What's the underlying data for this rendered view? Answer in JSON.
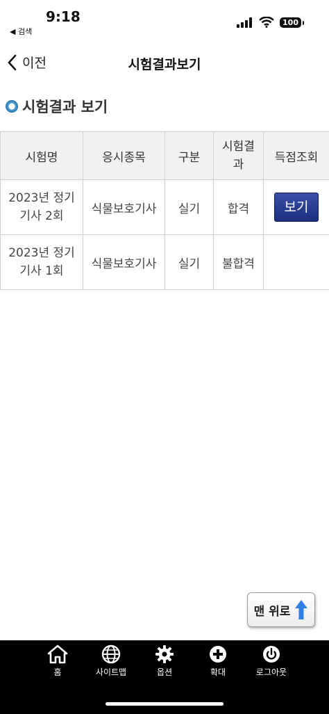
{
  "status_bar": {
    "time": "9:18",
    "back_app": "◀ 검색",
    "battery": "100"
  },
  "nav": {
    "back_label": "이전",
    "title": "시험결과보기"
  },
  "section": {
    "title": "시험결과 보기"
  },
  "table": {
    "headers": [
      "시험명",
      "응시종목",
      "구분",
      "시험결\n과",
      "득점조회"
    ],
    "rows": [
      {
        "exam": "2023년 정기\n기사 2회",
        "subject": "식물보호기사",
        "type": "실기",
        "result": "합격",
        "score_button": "보기"
      },
      {
        "exam": "2023년 정기\n기사 1회",
        "subject": "식물보호기사",
        "type": "실기",
        "result": "불합격",
        "score_button": ""
      }
    ]
  },
  "top_button": {
    "label": "맨 위로"
  },
  "bottom_nav": {
    "items": [
      {
        "label": "홈",
        "icon": "home-icon"
      },
      {
        "label": "사이트맵",
        "icon": "globe-icon"
      },
      {
        "label": "옵션",
        "icon": "gear-icon"
      },
      {
        "label": "확대",
        "icon": "plus-circle-icon"
      },
      {
        "label": "로그아웃",
        "icon": "power-icon"
      }
    ]
  },
  "colors": {
    "button_blue": "#1c2f7d",
    "header_bg": "#f1f1f1",
    "bottom_bar": "#000000",
    "arrow_blue": "#2f7fe6"
  }
}
